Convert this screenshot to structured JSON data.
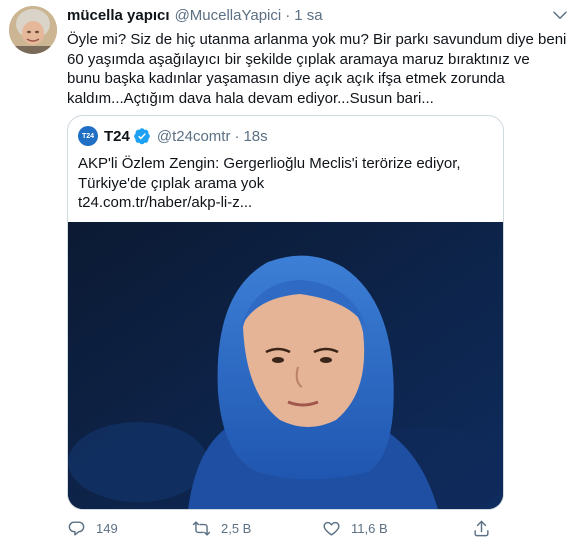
{
  "tweet": {
    "display_name": "mücella yapıcı",
    "handle": "@MucellaYapici",
    "separator": "·",
    "time": "1 sa",
    "text": "Öyle mi? Siz de hiç utanma arlanma yok mu? Bir parkı savundum diye beni 60 yaşımda aşağılayıcı bir şekilde çıplak aramaya maruz bıraktınız ve bunu başka kadınlar yaşamasın diye açık açık ifşa etmek zorunda kaldım...Açtığım dava hala devam ediyor...Susun bari..."
  },
  "quote": {
    "avatar_label": "T24",
    "display_name": "T24",
    "handle": "@t24comtr",
    "separator": "·",
    "time": "18s",
    "text": "AKP'li Özlem Zengin: Gergerlioğlu Meclis'i terörize ediyor, Türkiye'de çıplak arama yok",
    "link": "t24.com.tr/haber/akp-li-z..."
  },
  "actions": {
    "reply_count": "149",
    "retweet_count": "2,5 B",
    "like_count": "11,6 B"
  },
  "icons": [
    "more-icon",
    "verified-icon",
    "reply-icon",
    "retweet-icon",
    "like-icon",
    "share-icon"
  ],
  "colors": {
    "secondary_text": "#5b7083",
    "verified": "#1da1f2",
    "border": "#cfd9de"
  }
}
